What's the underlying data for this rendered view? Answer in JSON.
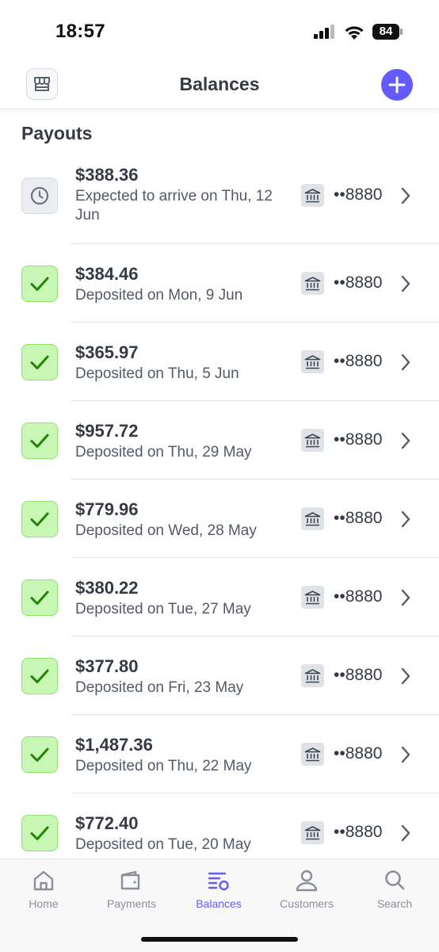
{
  "status_bar": {
    "time": "18:57",
    "battery": "84"
  },
  "header": {
    "title": "Balances"
  },
  "section": {
    "title": "Payouts"
  },
  "payouts": [
    {
      "amount": "$388.36",
      "desc": "Expected to arrive on Thu, 12 Jun",
      "status": "pending",
      "account": "••8880"
    },
    {
      "amount": "$384.46",
      "desc": "Deposited on Mon, 9 Jun",
      "status": "paid",
      "account": "••8880"
    },
    {
      "amount": "$365.97",
      "desc": "Deposited on Thu, 5 Jun",
      "status": "paid",
      "account": "••8880"
    },
    {
      "amount": "$957.72",
      "desc": "Deposited on Thu, 29 May",
      "status": "paid",
      "account": "••8880"
    },
    {
      "amount": "$779.96",
      "desc": "Deposited on Wed, 28 May",
      "status": "paid",
      "account": "••8880"
    },
    {
      "amount": "$380.22",
      "desc": "Deposited on Tue, 27 May",
      "status": "paid",
      "account": "••8880"
    },
    {
      "amount": "$377.80",
      "desc": "Deposited on Fri, 23 May",
      "status": "paid",
      "account": "••8880"
    },
    {
      "amount": "$1,487.36",
      "desc": "Deposited on Thu, 22 May",
      "status": "paid",
      "account": "••8880"
    },
    {
      "amount": "$772.40",
      "desc": "Deposited on Tue, 20 May",
      "status": "paid",
      "account": "••8880"
    }
  ],
  "tabs": [
    {
      "label": "Home",
      "icon": "home-icon",
      "active": false
    },
    {
      "label": "Payments",
      "icon": "wallet-icon",
      "active": false
    },
    {
      "label": "Balances",
      "icon": "balances-icon",
      "active": true
    },
    {
      "label": "Customers",
      "icon": "person-icon",
      "active": false
    },
    {
      "label": "Search",
      "icon": "search-icon",
      "active": false
    }
  ],
  "colors": {
    "accent": "#635bff",
    "paid_bg": "#c8f6b5",
    "paid_check": "#228403",
    "text": "#353a44"
  }
}
